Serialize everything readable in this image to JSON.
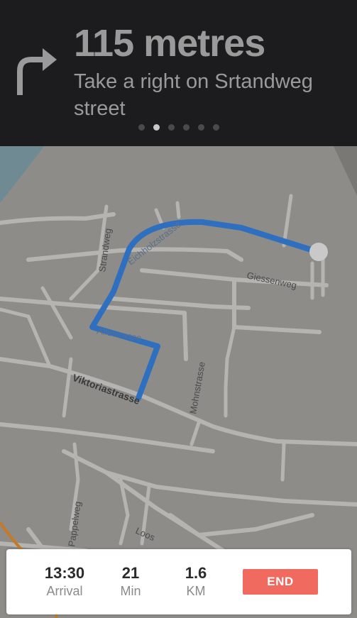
{
  "navigation": {
    "distance": "115 metres",
    "instruction": "Take a right on Srtandweg street",
    "maneuver_icon": "turn-right-arrow-icon",
    "pager": {
      "count": 6,
      "active_index": 1
    }
  },
  "map": {
    "streets": {
      "strandweg": "Strandweg",
      "eichholzstrasse": "Eichholzstrasse",
      "giessenweg": "Giessenweg",
      "aliestrasse": "Aliestrasse",
      "mohnstrasse": "Mohnstrasse",
      "viktoriastrasse": "Viktoriastrasse",
      "pappelweg": "Pappelweg",
      "loos": "Loos"
    },
    "colors": {
      "route": "#2e6fbf",
      "land": "#8e8c88",
      "road": "#b6b4b0",
      "water": "#6f8a93"
    }
  },
  "trip": {
    "arrival": {
      "value": "13:30",
      "label": "Arrival"
    },
    "duration": {
      "value": "21",
      "label": "Min"
    },
    "distance": {
      "value": "1.6",
      "label": "KM"
    },
    "end_label": "END",
    "end_color": "#f06a5f"
  }
}
